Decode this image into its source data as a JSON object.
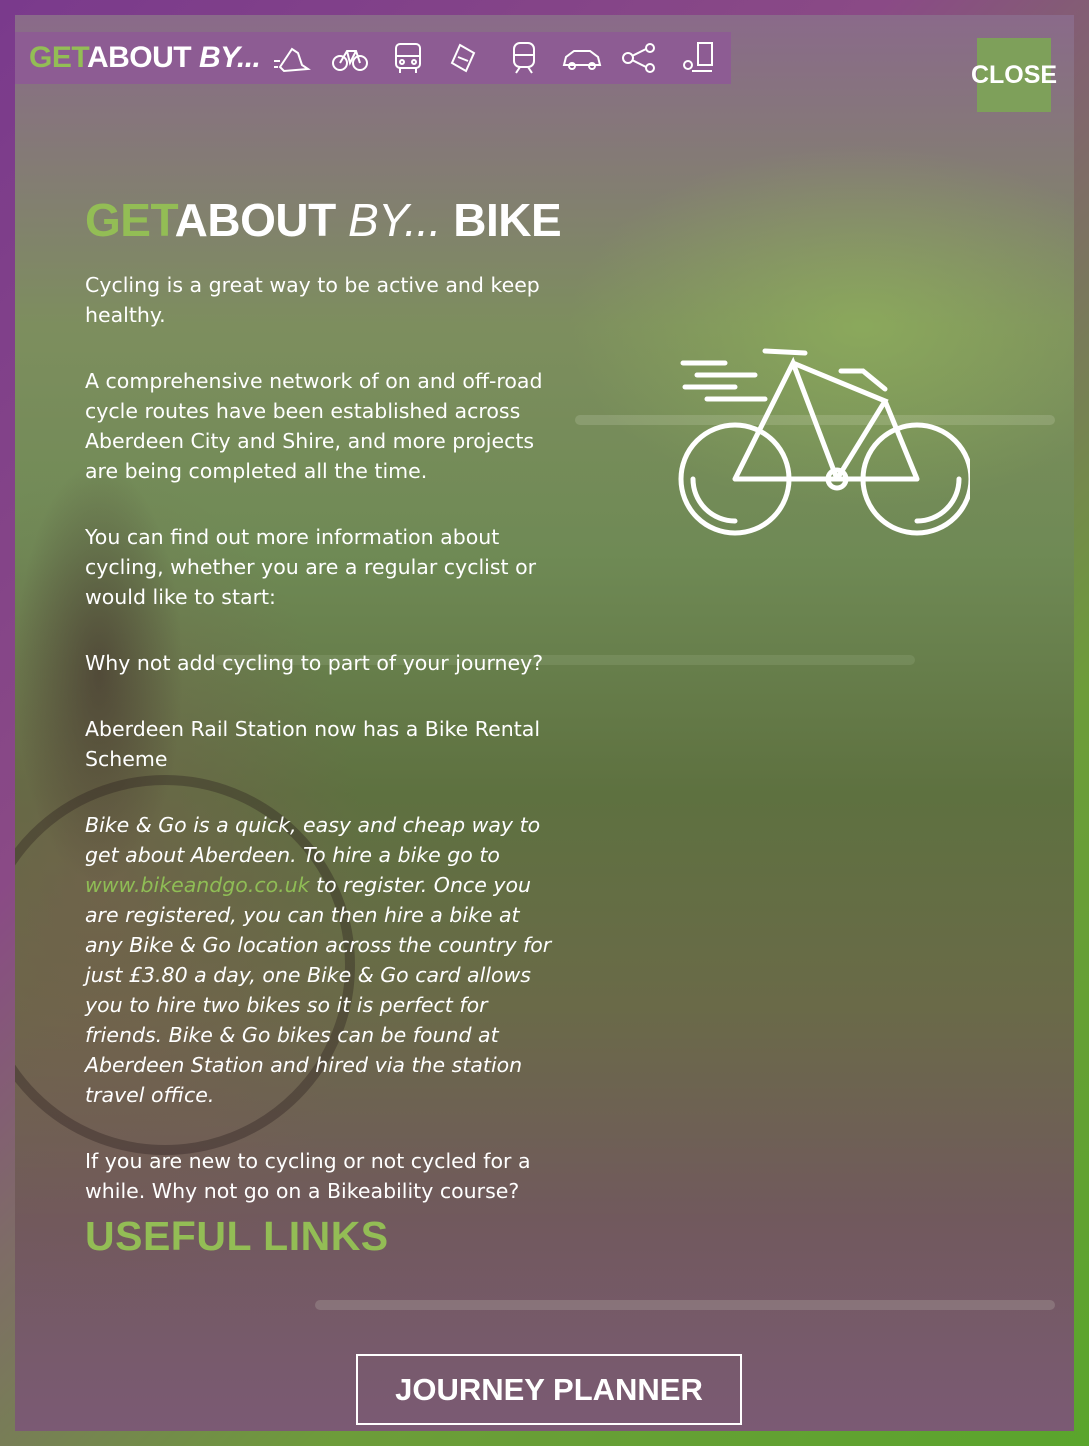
{
  "topbar": {
    "brand_get": "GET",
    "brand_about": "ABOUT",
    "brand_by": "BY...",
    "icons": [
      "walking-icon",
      "bicycle-icon",
      "bus-icon",
      "ticket-icon",
      "train-icon",
      "car-icon",
      "share-icon",
      "location-icon"
    ]
  },
  "close_label": "CLOSE",
  "page_title": {
    "get": "GET",
    "about": "ABOUT",
    "by": "BY...",
    "mode": "BIKE"
  },
  "paragraphs": [
    "Cycling is a great way to be active and keep healthy.",
    "A comprehensive network of on and off-road cycle routes have been established across Aberdeen City and Shire, and more projects are being completed all the time.",
    "You can find out more information about cycling, whether you are a regular cyclist or would like to start:",
    "Why not add cycling to part of your journey?",
    "Aberdeen Rail Station now has a Bike Rental Scheme"
  ],
  "bikego": {
    "before": "Bike & Go is a quick, easy and cheap way to get about Aberdeen. To hire a bike go to ",
    "link": "www.bikeandgo.co.uk",
    "after": " to register. Once you are registered, you can then hire a bike at any Bike & Go location across the country for just £3.80 a day, one Bike & Go card allows you to hire two bikes so it is perfect for friends. Bike & Go bikes can be found at Aberdeen Station and hired via the station travel office."
  },
  "bikeability": "If you are new to cycling or not cycled for a while. Why not go on a Bikeability course?",
  "useful_links_heading": "USEFUL LINKS",
  "journey_planner_label": "JOURNEY PLANNER",
  "colors": {
    "accent_green": "#93bd55",
    "topbar_purple": "#8d5c93",
    "close_green": "#7ea05a"
  }
}
